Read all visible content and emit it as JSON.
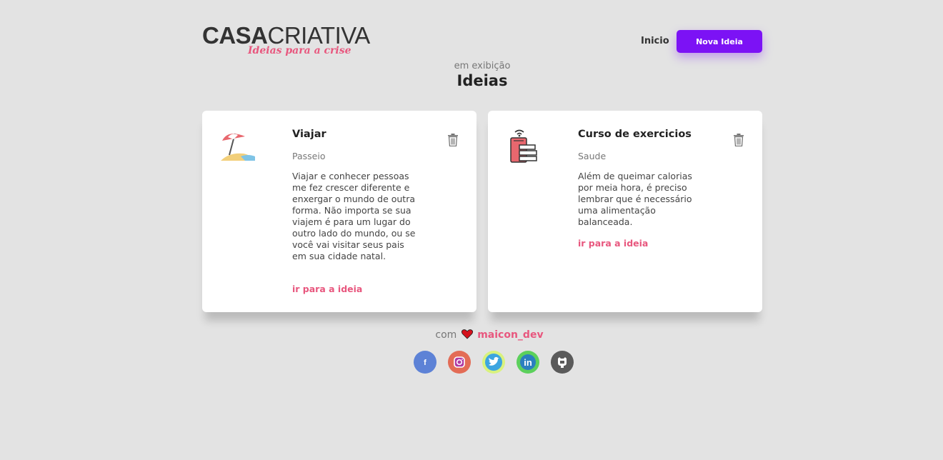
{
  "header": {
    "logo_main_bold": "CASA",
    "logo_main_light": "CRIATIVA",
    "logo_sub": "Ideias para a crise",
    "nav_inicio": "Inicio",
    "nav_nova_ideia": "Nova Ideia"
  },
  "heading": {
    "subtitle": "em exibição",
    "title": "Ideias"
  },
  "ideas": [
    {
      "icon": "beach-umbrella-icon",
      "title": "Viajar",
      "category": "Passeio",
      "description": "Viajar e conhecer pessoas me fez crescer diferente e enxergar o mundo de outra forma. Não importa se sua viajem é para um lugar do outro lado do mundo, ou se você vai visitar seus pais em sua cidade natal.",
      "link": "ir para a ideia"
    },
    {
      "icon": "exercise-machine-icon",
      "title": "Curso de exercicios",
      "category": "Saude",
      "description": "Além de queimar calorias por meia hora, é preciso lembrar que é necessário uma alimentação balanceada.",
      "link": "ir para a ideia"
    }
  ],
  "footer": {
    "prefix": "com",
    "author": "maicon_dev",
    "social": [
      "facebook-icon",
      "instagram-icon",
      "twitter-icon",
      "linkedin-icon",
      "github-icon"
    ]
  },
  "colors": {
    "background": "#e3e3e3",
    "accent_purple": "#7c12f5",
    "accent_pink": "#e8577e"
  }
}
